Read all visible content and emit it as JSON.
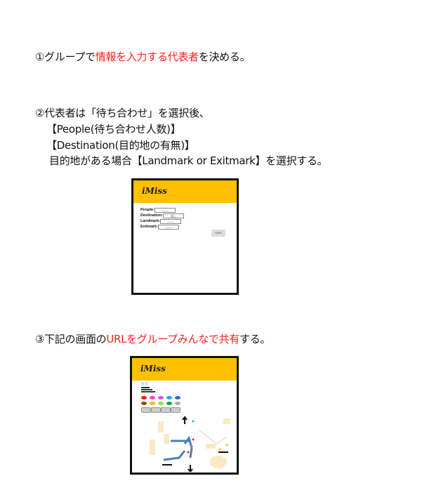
{
  "steps": {
    "step1": {
      "pre": "①グループで",
      "highlight": "情報を入力する代表者",
      "post": "を決める。"
    },
    "step2": {
      "line1": "②代表者は「待ち合わせ」を選択後、",
      "line2": "【People(待ち合わせ人数)】",
      "line3": "【Destination(目的地の有無)】",
      "line4": "目的地がある場合【Landmark or Exitmark】を選択する。"
    },
    "step3": {
      "pre": "③下記の画面の",
      "highlight": "URLをグループみんなで共有",
      "post": "する。"
    }
  },
  "mockup1": {
    "logo": "iMiss",
    "fields": [
      {
        "label": "People:",
        "value": "--------"
      },
      {
        "label": "Destination:",
        "value": "なし"
      },
      {
        "label": "Landmark:",
        "value": "--------"
      },
      {
        "label": "Exitmark:",
        "value": "--------"
      }
    ],
    "save_label": "save"
  },
  "mockup2": {
    "logo": "iMiss",
    "link": "戻る",
    "colors": [
      "#ee1c1c",
      "#ff44cc",
      "#cc55ee",
      "#22aaee",
      "#3366bb",
      "#994411",
      "#ffbb00",
      "#99dd44",
      "#11aa44",
      "#aaaaaa"
    ]
  }
}
